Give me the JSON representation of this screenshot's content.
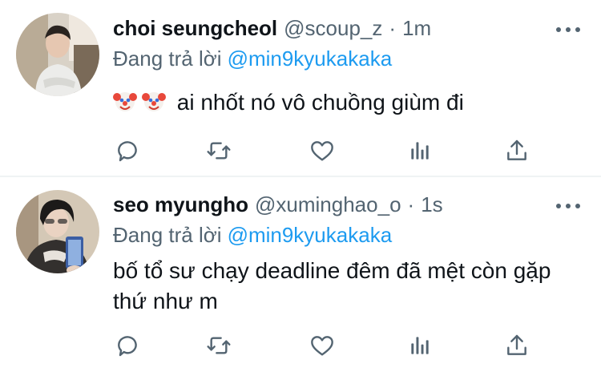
{
  "tweets": [
    {
      "display_name": "choi seungcheol",
      "handle": "@scoup_z",
      "separator": "·",
      "time": "1m",
      "reply_prefix": "Đang trả lời",
      "reply_to": "@min9kyukakaka",
      "text": "ai nhốt nó vô chuồng giùm đi",
      "emojis": [
        "clown-face",
        "clown-face"
      ],
      "actions": [
        "reply-icon",
        "retweet-icon",
        "like-icon",
        "views-icon",
        "share-icon"
      ]
    },
    {
      "display_name": "seo myungho",
      "handle": "@xuminghao_o",
      "separator": "·",
      "time": "1s",
      "reply_prefix": "Đang trả lời",
      "reply_to": "@min9kyukakaka",
      "text": "bố tổ sư chạy deadline đêm đã mệt còn gặp thứ như m",
      "emojis": [],
      "actions": [
        "reply-icon",
        "retweet-icon",
        "like-icon",
        "views-icon",
        "share-icon"
      ]
    }
  ],
  "colors": {
    "name": "#0f1419",
    "secondary": "#536471",
    "link": "#1d9bf0",
    "separator": "#eff3f4"
  }
}
